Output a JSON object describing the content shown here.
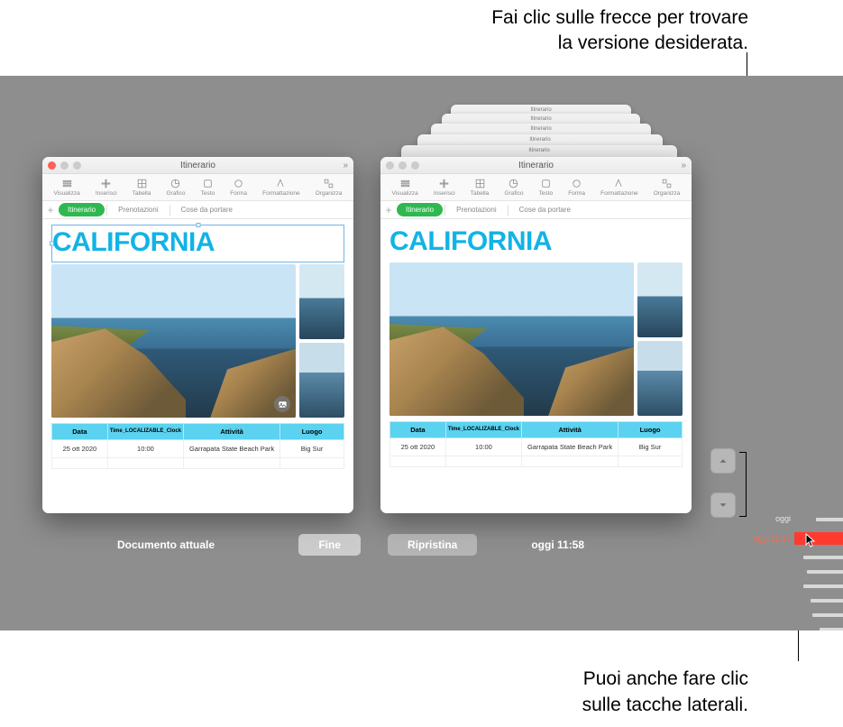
{
  "annotations": {
    "top_line1": "Fai clic sulle frecce per trovare",
    "top_line2": "la versione desiderata.",
    "bottom_line1": "Puoi anche fare clic",
    "bottom_line2": "sulle tacche laterali."
  },
  "ghost_title": "Itinerario",
  "window": {
    "title": "Itinerario",
    "toolbar": {
      "visualizza": "Visualizza",
      "inserisci": "Inserisci",
      "tabella": "Tabella",
      "grafico": "Grafico",
      "testo": "Testo",
      "forma": "Forma",
      "formattazione": "Formattazione",
      "organizza": "Organizza"
    },
    "tabs": {
      "itinerario": "Itinerario",
      "prenotazioni": "Prenotazioni",
      "cose": "Cose da portare"
    },
    "headline": "CALIFORNIA",
    "table": {
      "headers": {
        "data": "Data",
        "time": "Time_LOCALIZABLE_Clock",
        "attivita": "Attività",
        "luogo": "Luogo"
      },
      "row1": {
        "data": "25 ott 2020",
        "time": "10:00",
        "attivita": "Garrapata State Beach Park",
        "luogo": "Big Sur"
      }
    }
  },
  "actions": {
    "current_doc": "Documento attuale",
    "done": "Fine",
    "restore": "Ripristina",
    "timestamp": "oggi 11:58"
  },
  "timeline": {
    "oggi": "oggi",
    "selected": "oggi 11:17"
  }
}
